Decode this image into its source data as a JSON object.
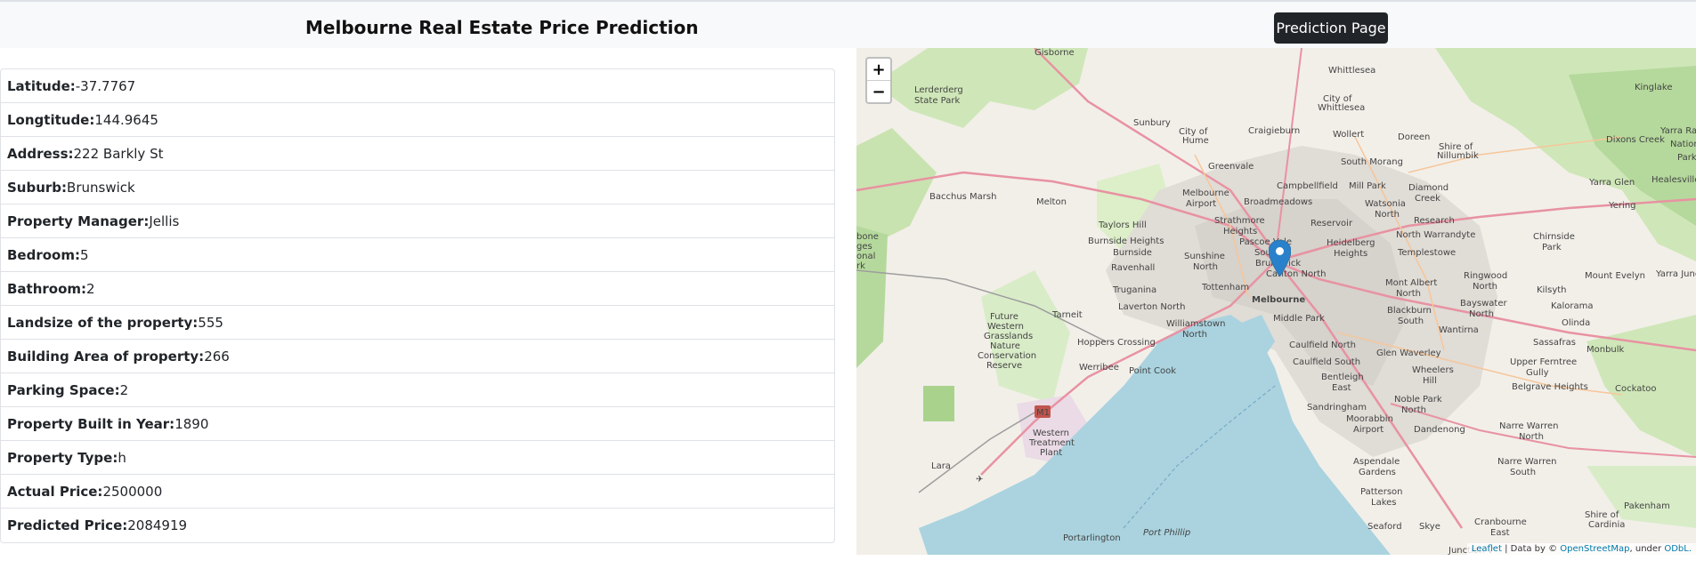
{
  "header": {
    "title": "Melbourne Real Estate Price Prediction",
    "prediction_button": "Prediction Page"
  },
  "details": [
    {
      "label": "Latitude:",
      "value": "-37.7767"
    },
    {
      "label": "Longtitude:",
      "value": "144.9645"
    },
    {
      "label": "Address:",
      "value": "222 Barkly St"
    },
    {
      "label": "Suburb:",
      "value": "Brunswick"
    },
    {
      "label": "Property Manager:",
      "value": "Jellis"
    },
    {
      "label": "Bedroom:",
      "value": "5"
    },
    {
      "label": "Bathroom:",
      "value": "2"
    },
    {
      "label": "Landsize of the property:",
      "value": "555"
    },
    {
      "label": "Building Area of property:",
      "value": "266"
    },
    {
      "label": "Parking Space:",
      "value": "2"
    },
    {
      "label": "Property Built in Year:",
      "value": "1890"
    },
    {
      "label": "Property Type:",
      "value": "h"
    },
    {
      "label": "Actual Price:",
      "value": "2500000"
    },
    {
      "label": "Predicted Price:",
      "value": "2084919"
    }
  ],
  "map": {
    "zoom_in": "+",
    "zoom_out": "−",
    "attribution": {
      "leaflet": "Leaflet",
      "separator": " | Data by © ",
      "osm": "OpenStreetMap",
      "under": ", under ",
      "odbl": "ODbL."
    },
    "city_label": "Melbourne",
    "bay_label": "Port Phillip",
    "place_labels": [
      "Gisborne",
      "Whittlesea",
      "Kinglake",
      "Lerderderg State Park",
      "Sunbury",
      "Craigieburn",
      "Wollert",
      "Doreen",
      "Dixons Creek",
      "Yarra Ranges National Park",
      "Greenvale",
      "South Morang",
      "Yarra Glen",
      "Healesville",
      "Bacchus Marsh",
      "Melton",
      "Campbellfield",
      "Mill Park",
      "Diamond Creek",
      "Yering",
      "Melbourne Airport",
      "Broadmeadows",
      "Watsonia North",
      "Research",
      "Taylors Hill",
      "Strathmore Heights",
      "Reservoir",
      "North Warrandyte",
      "Chirnside Park",
      "Burnside Heights",
      "Pascoe Vale South",
      "Heidelberg Heights",
      "Templestowe",
      "Sunshine North",
      "Brunswick",
      "Ravenhall",
      "Carlton North",
      "Mont Albert North",
      "Ringwood North",
      "Mount Evelyn",
      "Yarra Junction",
      "Truganina",
      "Tottenham",
      "Kilsyth",
      "Tarneit",
      "Laverton North",
      "Middle Park",
      "Blackburn South",
      "Bayswater North",
      "Kalorama",
      "Future Western Grasslands Nature Conservation Reserve",
      "Williamstown North",
      "Wantirna",
      "Olinda",
      "Hoppers Crossing",
      "Caulfield North",
      "Glen Waverley",
      "Sassafras",
      "Monbulk",
      "Werribee",
      "Point Cook",
      "Caulfield South",
      "Wheelers Hill",
      "Upper Ferntree Gully",
      "Bentleigh East",
      "Belgrave Heights",
      "Cockatoo",
      "M1",
      "Sandringham",
      "Noble Park North",
      "Western Treatment Plant",
      "Moorabbin Airport",
      "Dandenong",
      "Narre Warren North",
      "Lara",
      "Aspendale Gardens",
      "Narre Warren South",
      "Patterson Lakes",
      "Pakenham",
      "Seaford",
      "Skye",
      "Cranbourne East",
      "Shire of Cardinia",
      "Portarlington",
      "Junction Village",
      "City of Hume",
      "City of Whittlesea",
      "Shire of Nillumbik"
    ]
  }
}
